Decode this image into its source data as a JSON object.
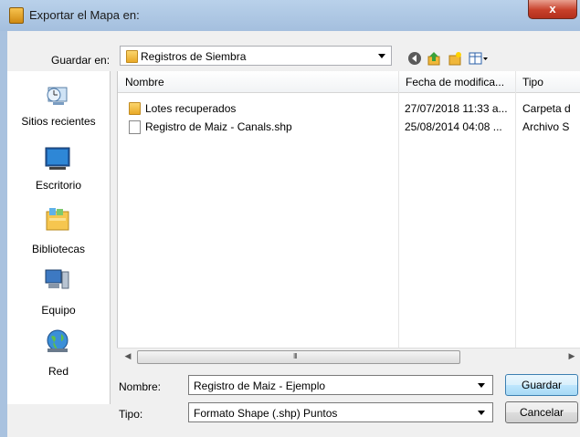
{
  "window": {
    "title": "Exportar el Mapa en:",
    "close_glyph": "x"
  },
  "toolbar": {
    "save_in_label": "Guardar en:",
    "current_folder": "Registros de Siembra",
    "icons": [
      "back-icon",
      "up-folder-icon",
      "new-folder-icon",
      "view-menu-icon"
    ]
  },
  "places": [
    {
      "label": "Sitios recientes",
      "icon": "recent-places-icon"
    },
    {
      "label": "Escritorio",
      "icon": "desktop-icon"
    },
    {
      "label": "Bibliotecas",
      "icon": "libraries-icon"
    },
    {
      "label": "Equipo",
      "icon": "computer-icon"
    },
    {
      "label": "Red",
      "icon": "network-icon"
    }
  ],
  "file_list": {
    "columns": [
      "Nombre",
      "Fecha de modifica...",
      "Tipo"
    ],
    "rows": [
      {
        "name": "Lotes recuperados",
        "date": "27/07/2018 11:33 a...",
        "type": "Carpeta d",
        "icon": "folder-icon"
      },
      {
        "name": "Registro de Maiz - Canals.shp",
        "date": "25/08/2014 04:08 ...",
        "type": "Archivo S",
        "icon": "file-icon"
      }
    ],
    "scroll_grip": "III"
  },
  "bottom": {
    "name_label": "Nombre:",
    "name_value": "Registro de Maiz - Ejemplo",
    "type_label": "Tipo:",
    "type_value": "Formato Shape (.shp) Puntos",
    "save_button": "Guardar",
    "cancel_button": "Cancelar"
  },
  "colors": {
    "titlebar": "#b9d1ea",
    "close_button": "#c7402a",
    "default_button": "#bee6fd"
  }
}
